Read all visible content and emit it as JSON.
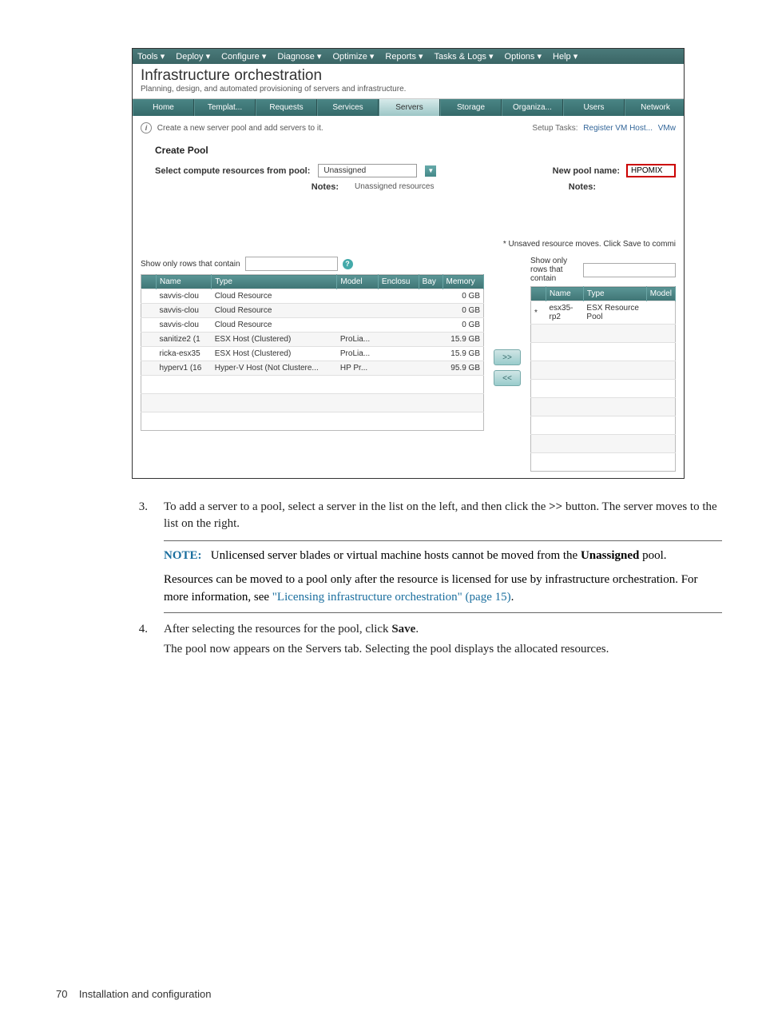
{
  "menubar": [
    "Tools ▾",
    "Deploy ▾",
    "Configure ▾",
    "Diagnose ▾",
    "Optimize ▾",
    "Reports ▾",
    "Tasks & Logs ▾",
    "Options ▾",
    "Help ▾"
  ],
  "app": {
    "title": "Infrastructure orchestration",
    "subtitle": "Planning, design, and automated provisioning of servers and infrastructure."
  },
  "tabs": [
    "Home",
    "Templat...",
    "Requests",
    "Services",
    "Servers",
    "Storage",
    "Organiza...",
    "Users",
    "Network"
  ],
  "activeTab": "Servers",
  "info_line": "Create a new server pool and add servers to it.",
  "setup_tasks_label": "Setup Tasks:",
  "setup_links": [
    "Register VM Host...",
    "VMw"
  ],
  "create_pool": {
    "heading": "Create Pool",
    "select_label": "Select compute resources from pool:",
    "select_value": "Unassigned",
    "notes_label": "Notes:",
    "notes_value": "Unassigned resources",
    "new_pool_label": "New pool name:",
    "new_pool_value": "HPOMIX",
    "right_notes_label": "Notes:",
    "unsaved": "* Unsaved resource moves. Click Save to commi"
  },
  "filter_label": "Show only rows that contain",
  "left_table": {
    "headers": [
      "Name",
      "Type",
      "Model",
      "Enclosu",
      "Bay",
      "Memory"
    ],
    "rows": [
      {
        "name": "savvis-clou",
        "type": "Cloud Resource",
        "model": "",
        "enc": "",
        "bay": "",
        "mem": "0 GB"
      },
      {
        "name": "savvis-clou",
        "type": "Cloud Resource",
        "model": "",
        "enc": "",
        "bay": "",
        "mem": "0 GB"
      },
      {
        "name": "savvis-clou",
        "type": "Cloud Resource",
        "model": "",
        "enc": "",
        "bay": "",
        "mem": "0 GB"
      },
      {
        "name": "sanitize2 (1",
        "type": "ESX Host (Clustered)",
        "model": "ProLia...",
        "enc": "",
        "bay": "",
        "mem": "15.9 GB"
      },
      {
        "name": "ricka-esx35",
        "type": "ESX Host (Clustered)",
        "model": "ProLia...",
        "enc": "",
        "bay": "",
        "mem": "15.9 GB"
      },
      {
        "name": "hyperv1 (16",
        "type": "Hyper-V Host (Not Clustere...",
        "model": "HP Pr...",
        "enc": "",
        "bay": "",
        "mem": "95.9 GB"
      }
    ]
  },
  "right_table": {
    "headers": [
      "Name",
      "Type",
      "Model"
    ],
    "rows": [
      {
        "mark": "*",
        "name": "esx35-rp2",
        "type": "ESX Resource Pool",
        "model": ""
      }
    ]
  },
  "move_btns": {
    "add": ">>",
    "remove": "<<"
  },
  "instructions": {
    "step3_num": "3.",
    "step3": "To add a server to a pool, select a server in the list on the left, and then click the >> button. The server moves to the list on the right.",
    "note_label": "NOTE:",
    "note1": "Unlicensed server blades or virtual machine hosts cannot be moved from the Unassigned pool.",
    "note2a": "Resources can be moved to a pool only after the resource is licensed for use by infrastructure orchestration. For more information, see ",
    "note2b": "\"Licensing infrastructure orchestration\" (page 15)",
    "note2c": ".",
    "step4_num": "4.",
    "step4": "After selecting the resources for the pool, click Save.",
    "step4b": "The pool now appears on the Servers tab. Selecting the pool displays the allocated resources."
  },
  "footer": {
    "page": "70",
    "section": "Installation and configuration"
  }
}
